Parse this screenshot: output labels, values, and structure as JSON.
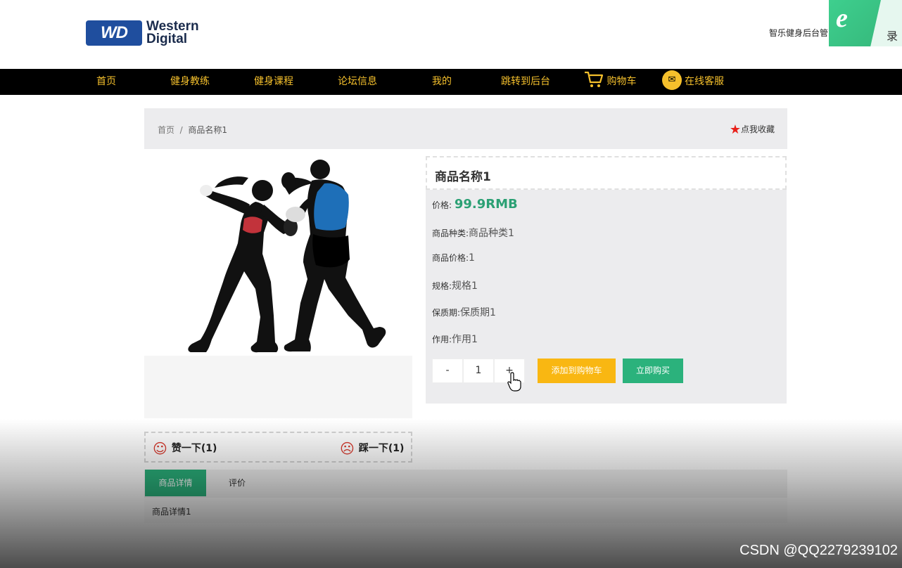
{
  "header": {
    "logo_badge": "WD",
    "logo_line1": "Western",
    "logo_line2": "Digital",
    "admin_link": "智乐健身后台管",
    "overlay_logo": "e",
    "overlay_text": "录"
  },
  "nav": {
    "items": [
      "首页",
      "健身教练",
      "健身课程",
      "论坛信息",
      "我的",
      "跳转到后台"
    ],
    "cart_label": "购物车",
    "service_label": "在线客服",
    "color": "#f5c02c"
  },
  "breadcrumb": {
    "home": "首页",
    "separator": "/",
    "current": "商品名称1",
    "favorite_label": "点我收藏"
  },
  "product": {
    "name": "商品名称1",
    "price_label": "价格:",
    "price": "99.9RMB",
    "category_label": "商品种类:",
    "category": "商品种类1",
    "unit_price_label": "商品价格:",
    "unit_price": "1",
    "spec_label": "规格:",
    "spec": "规格1",
    "shelf_life_label": "保质期:",
    "shelf_life": "保质期1",
    "usage_label": "作用:",
    "usage": "作用1",
    "quantity": "1",
    "minus": "-",
    "plus": "+",
    "add_to_cart": "添加到购物车",
    "buy_now": "立即购买"
  },
  "votes": {
    "like": "赞一下(1)",
    "dislike": "踩一下(1)"
  },
  "tabs": {
    "details": "商品详情",
    "reviews": "评价",
    "content": "商品详情1"
  },
  "watermark": "CSDN @QQ2279239102",
  "colors": {
    "accent_green": "#2bb27c",
    "accent_orange": "#f9b712",
    "nav_bg": "#000000",
    "nav_text": "#f5c02c"
  }
}
